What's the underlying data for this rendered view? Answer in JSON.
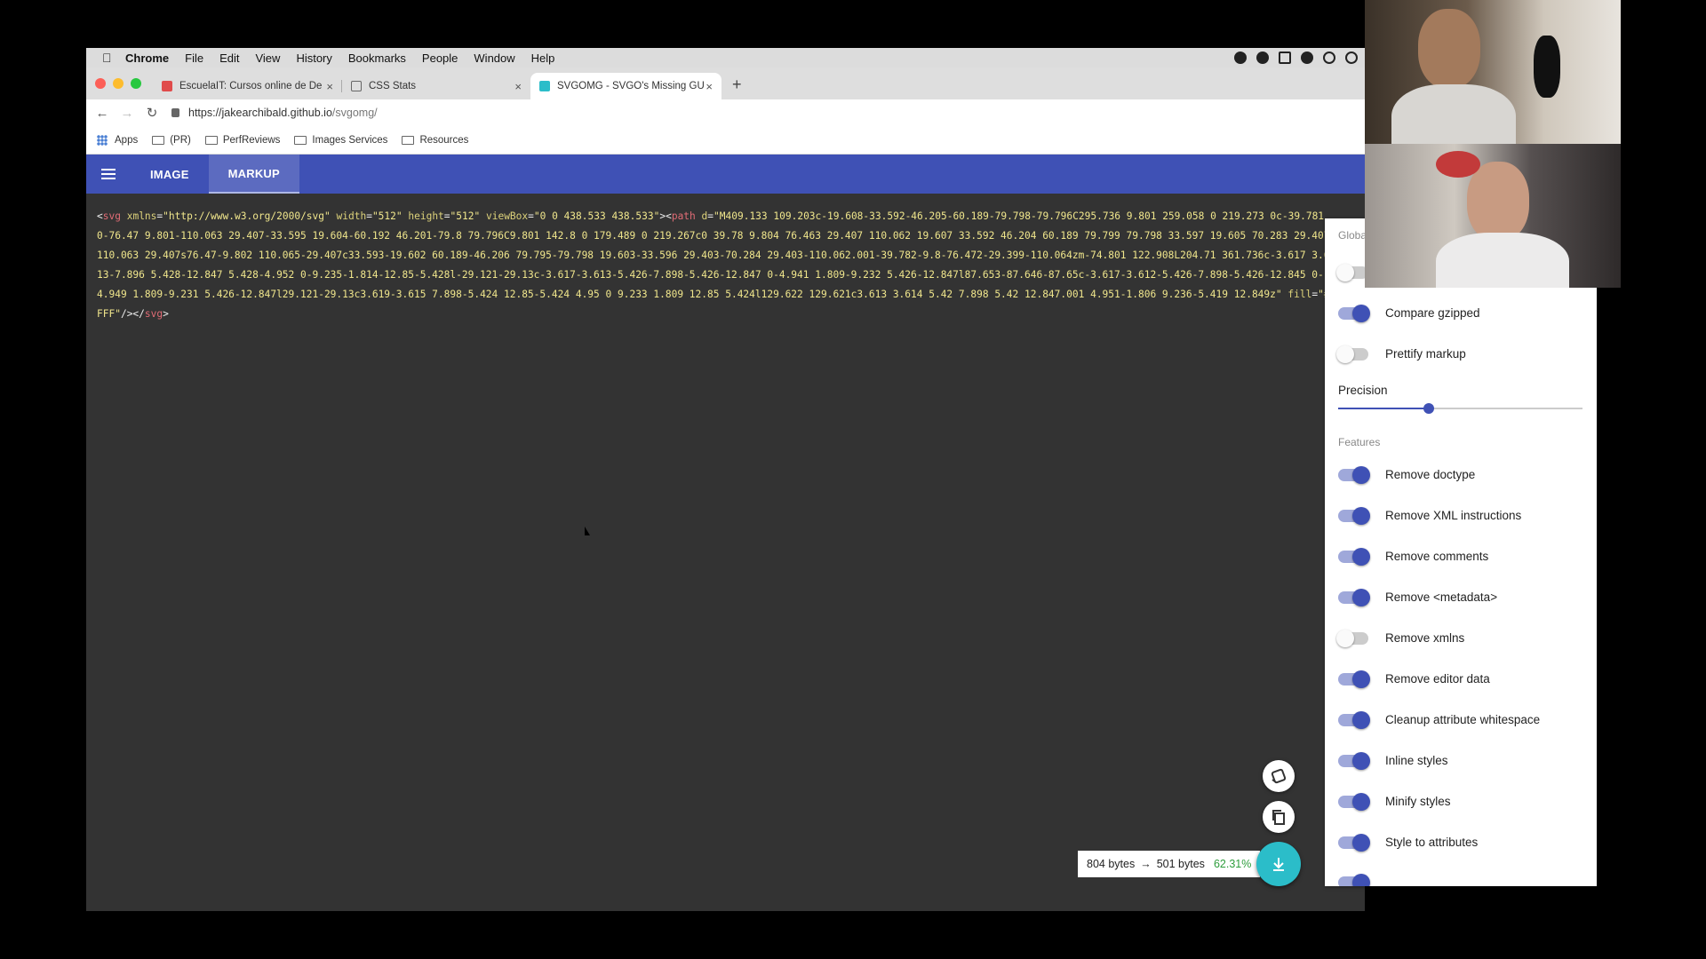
{
  "menubar": {
    "app": "Chrome",
    "items": [
      "File",
      "Edit",
      "View",
      "History",
      "Bookmarks",
      "People",
      "Window",
      "Help"
    ]
  },
  "tabs": [
    {
      "title": "EscuelaIT: Cursos online de De",
      "favicon_color": "#e04b4b"
    },
    {
      "title": "CSS Stats",
      "favicon_color": "#666666"
    },
    {
      "title": "SVGOMG - SVGO's Missing GU",
      "favicon_color": "#2bbdc9"
    }
  ],
  "address": {
    "host": "https://jakearchibald.github.io",
    "path": "/svgomg/"
  },
  "bookmarks": [
    "Apps",
    "(PR)",
    "PerfReviews",
    "Images Services",
    "Resources"
  ],
  "app": {
    "tabs": [
      "IMAGE",
      "MARKUP"
    ],
    "active_tab": "MARKUP"
  },
  "markup": {
    "open_tag": "svg",
    "svg_attrs": [
      {
        "name": "xmlns",
        "value": "\"http://www.w3.org/2000/svg\""
      },
      {
        "name": "width",
        "value": "\"512\""
      },
      {
        "name": "height",
        "value": "\"512\""
      },
      {
        "name": "viewBox",
        "value": "\"0 0 438.533 438.533\""
      }
    ],
    "path_tag": "path",
    "path_d_name": "d",
    "path_d": "\"M409.133 109.203c-19.608-33.592-46.205-60.189-79.798-79.796C295.736 9.801 259.058 0 219.273 0c-39.781 0-76.47 9.801-110.063 29.407-33.595 19.604-60.192 46.201-79.8 79.796C9.801 142.8 0 179.489 0 219.267c0 39.78 9.804 76.463 29.407 110.062 19.607 33.592 46.204 60.189 79.799 79.798 33.597 19.605 70.283 29.407 110.063 29.407s76.47-9.802 110.065-29.407c33.593-19.602 60.189-46.206 79.795-79.798 19.603-33.596 29.403-70.284 29.403-110.062.001-39.782-9.8-76.472-29.399-110.064zm-74.801 122.908L204.71 361.736c-3.617 3.613-7.896 5.428-12.847 5.428-4.952 0-9.235-1.814-12.85-5.428l-29.121-29.13c-3.617-3.613-5.426-7.898-5.426-12.847 0-4.941 1.809-9.232 5.426-12.847l87.653-87.646-87.65c-3.617-3.612-5.426-7.898-5.426-12.845 0-4.949 1.809-9.231 5.426-12.847l29.121-29.13c3.619-3.615 7.898-5.424 12.85-5.424 4.95 0 9.233 1.809 12.85 5.424l129.622 129.621c3.613 3.614 5.42 7.898 5.42 12.847.001 4.951-1.806 9.236-5.419 12.849z\"",
    "fill_name": "fill",
    "fill_value": "\"#FFF\"",
    "close": "/></",
    "close_tag": "svg",
    "close_end": ">"
  },
  "settings": {
    "global_heading": "Global",
    "global_items": [
      {
        "label": "Compare gzipped",
        "on": true
      },
      {
        "label": "Prettify markup",
        "on": false
      }
    ],
    "precision_label": "Precision",
    "precision_fraction": 0.37,
    "features_heading": "Features",
    "features": [
      {
        "label": "Remove doctype",
        "on": true
      },
      {
        "label": "Remove XML instructions",
        "on": true
      },
      {
        "label": "Remove comments",
        "on": true
      },
      {
        "label": "Remove <metadata>",
        "on": true
      },
      {
        "label": "Remove xmlns",
        "on": false
      },
      {
        "label": "Remove editor data",
        "on": true
      },
      {
        "label": "Cleanup attribute whitespace",
        "on": true
      },
      {
        "label": "Inline styles",
        "on": true
      },
      {
        "label": "Minify styles",
        "on": true
      },
      {
        "label": "Style to attributes",
        "on": true
      }
    ]
  },
  "results": {
    "original": "804 bytes",
    "arrow": "→",
    "optimized": "501 bytes",
    "percent": "62.31%"
  },
  "icons": {
    "fab_tilt": "tilt-icon",
    "fab_copy": "copy-icon",
    "fab_download": "download-icon"
  },
  "colors": {
    "primary": "#3f51b5",
    "accent": "#2bbdc9",
    "code_background": "#333333",
    "tag": "#e06c75",
    "attribute_text": "#e8e07b"
  }
}
